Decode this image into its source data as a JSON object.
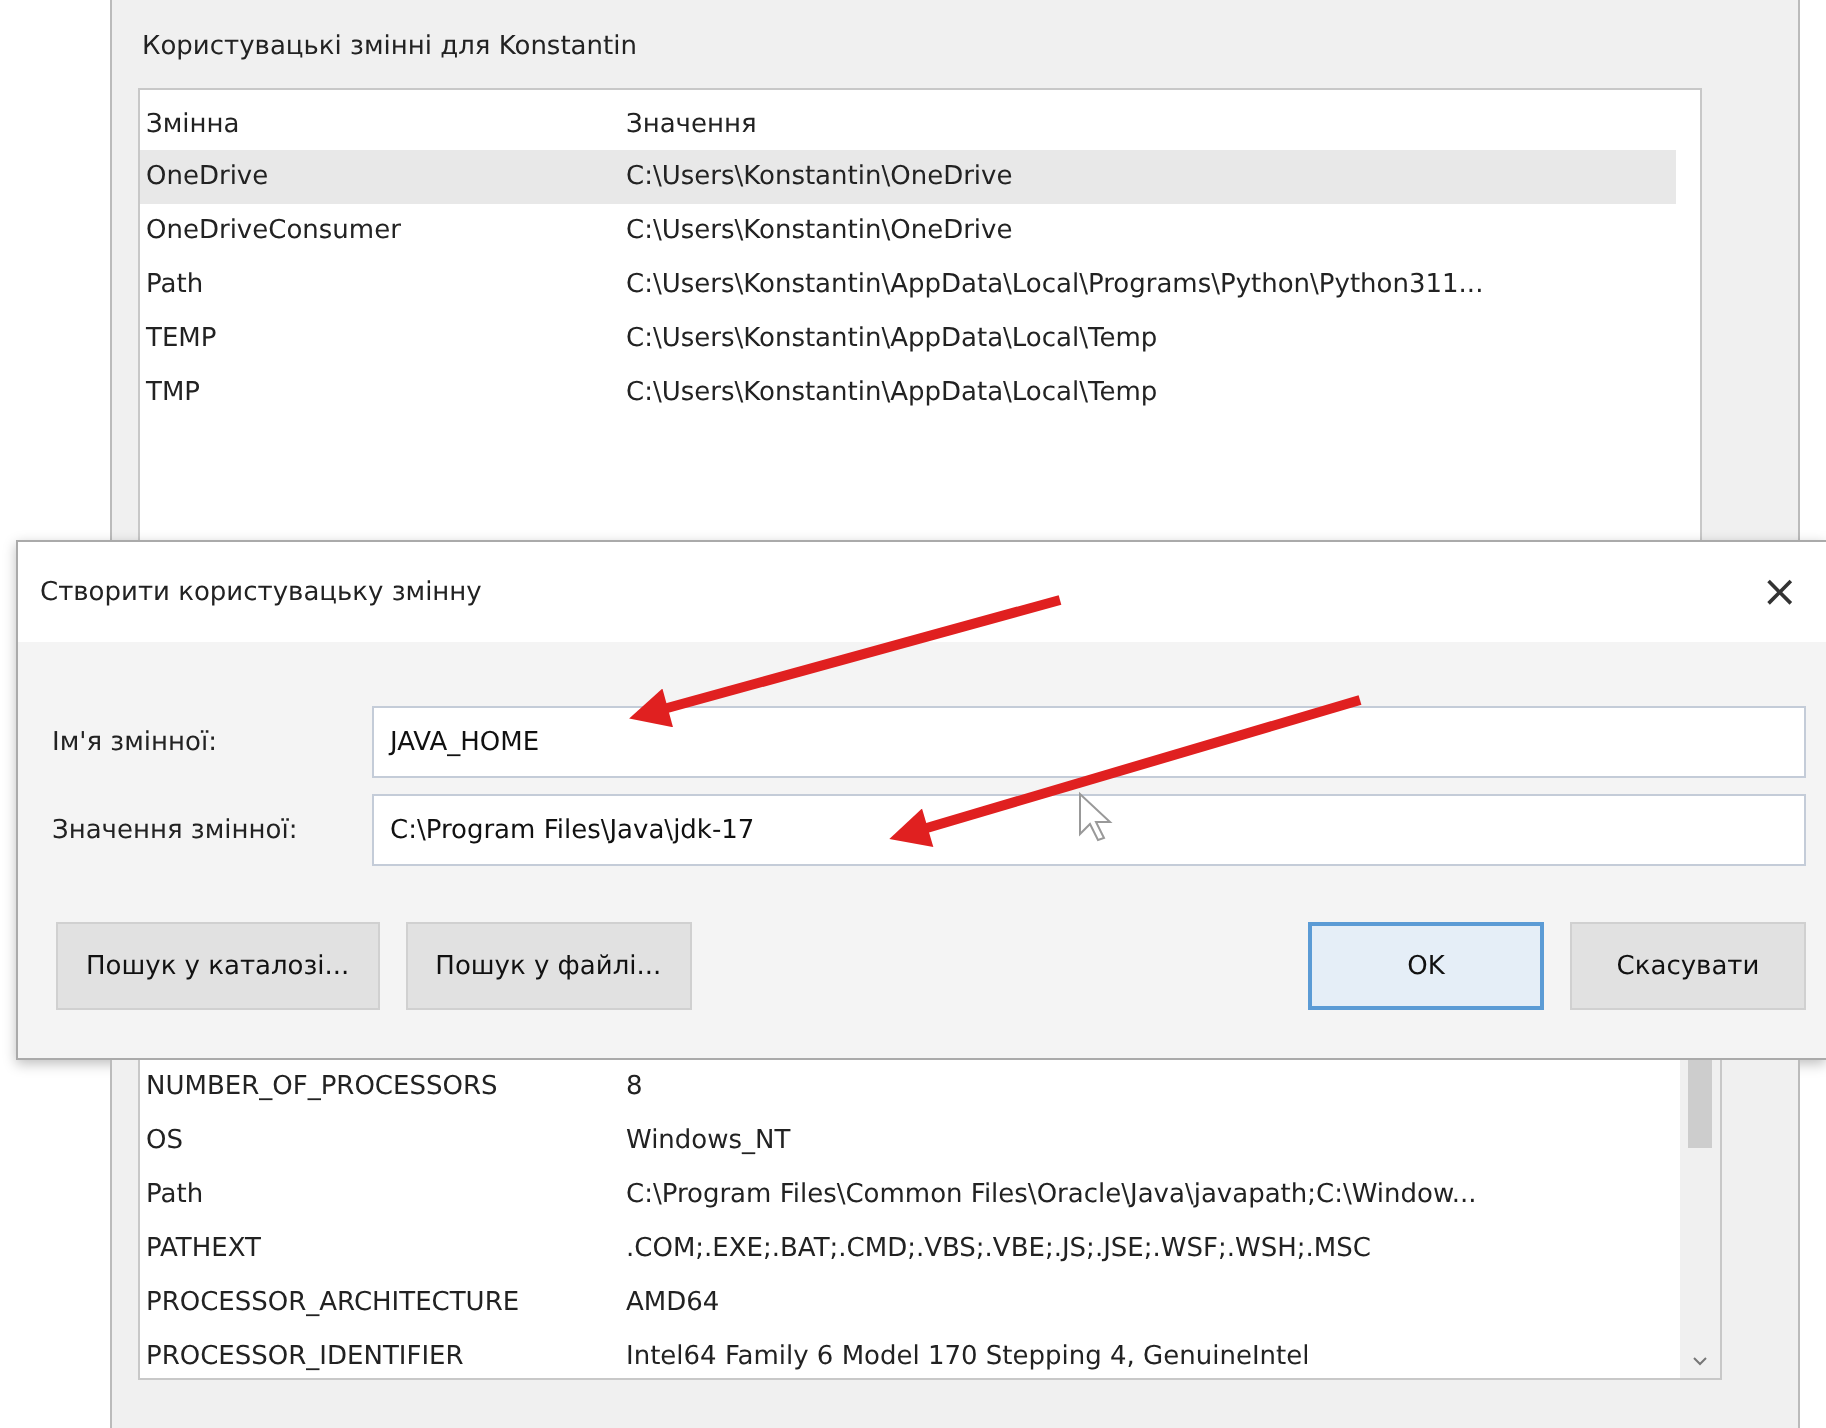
{
  "user_vars": {
    "title": "Користувацькі змінні для Konstantin",
    "columns": [
      "Змінна",
      "Значення"
    ],
    "rows": [
      {
        "name": "OneDrive",
        "value": "C:\\Users\\Konstantin\\OneDrive",
        "selected": true
      },
      {
        "name": "OneDriveConsumer",
        "value": "C:\\Users\\Konstantin\\OneDrive",
        "selected": false
      },
      {
        "name": "Path",
        "value": "C:\\Users\\Konstantin\\AppData\\Local\\Programs\\Python\\Python311...",
        "selected": false
      },
      {
        "name": "TEMP",
        "value": "C:\\Users\\Konstantin\\AppData\\Local\\Temp",
        "selected": false
      },
      {
        "name": "TMP",
        "value": "C:\\Users\\Konstantin\\AppData\\Local\\Temp",
        "selected": false
      }
    ]
  },
  "dialog": {
    "title": "Створити користувацьку змінну",
    "close": "×",
    "fields": [
      {
        "label": "Ім'я змінної:",
        "value": "JAVA_HOME"
      },
      {
        "label": "Значення змінної:",
        "value": "C:\\Program Files\\Java\\jdk-17"
      }
    ],
    "buttons": [
      {
        "label": "Пошук у каталозі...",
        "kind": "left",
        "focused": false
      },
      {
        "label": "Пошук у файлі...",
        "kind": "left",
        "focused": false
      },
      {
        "label": "OK",
        "kind": "right",
        "focused": true
      },
      {
        "label": "Скасувати",
        "kind": "right",
        "focused": false
      }
    ]
  },
  "system_vars": {
    "rows": [
      {
        "name": "NUMBER_OF_PROCESSORS",
        "value": "8",
        "selected": false
      },
      {
        "name": "OS",
        "value": "Windows_NT",
        "selected": false
      },
      {
        "name": "Path",
        "value": "C:\\Program Files\\Common Files\\Oracle\\Java\\javapath;C:\\Window...",
        "selected": false
      },
      {
        "name": "PATHEXT",
        "value": ".COM;.EXE;.BAT;.CMD;.VBS;.VBE;.JS;.JSE;.WSF;.WSH;.MSC",
        "selected": false
      },
      {
        "name": "PROCESSOR_ARCHITECTURE",
        "value": "AMD64",
        "selected": false
      },
      {
        "name": "PROCESSOR_IDENTIFIER",
        "value": "Intel64 Family 6 Model 170 Stepping 4, GenuineIntel",
        "selected": false
      }
    ]
  }
}
